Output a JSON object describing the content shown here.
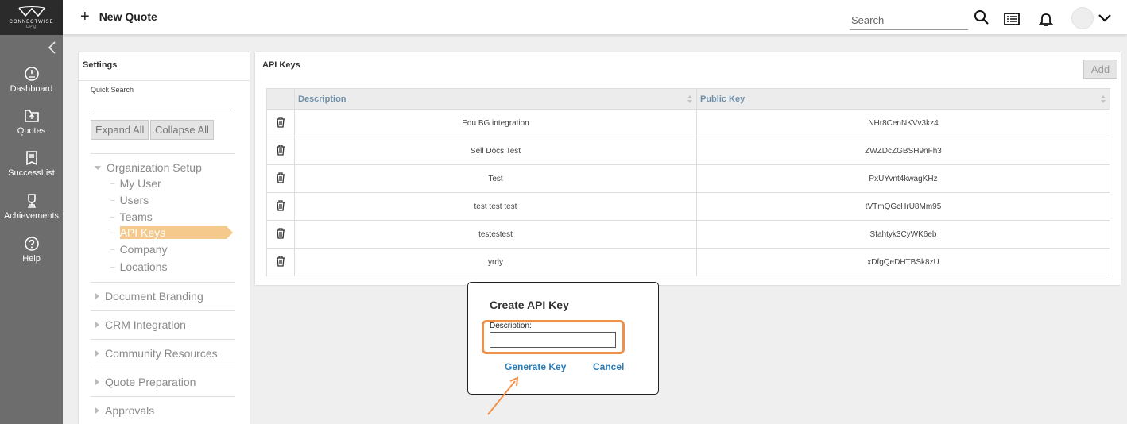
{
  "brand": {
    "name": "CONNECTWISE",
    "sub": "CPQ"
  },
  "nav": [
    {
      "label": "Dashboard",
      "icon": "dashboard-icon"
    },
    {
      "label": "Quotes",
      "icon": "quotes-icon"
    },
    {
      "label": "SuccessList",
      "icon": "successlist-icon"
    },
    {
      "label": "Achievements",
      "icon": "trophy-icon"
    },
    {
      "label": "Help",
      "icon": "help-icon"
    }
  ],
  "topbar": {
    "new_quote": "New Quote",
    "search_placeholder": "Search"
  },
  "settings": {
    "title": "Settings",
    "quick_search_label": "Quick Search",
    "expand_all": "Expand All",
    "collapse_all": "Collapse All",
    "org_setup": "Organization Setup",
    "org_items": [
      "My User",
      "Users",
      "Teams",
      "API Keys",
      "Company",
      "Locations"
    ],
    "categories": [
      "Document Branding",
      "CRM Integration",
      "Community Resources",
      "Quote Preparation",
      "Approvals"
    ]
  },
  "api_keys": {
    "title": "API Keys",
    "add_label": "Add",
    "columns": [
      "Description",
      "Public Key"
    ],
    "rows": [
      {
        "description": "Edu BG integration",
        "public_key": "NHr8CenNKVv3kz4"
      },
      {
        "description": "Sell Docs Test",
        "public_key": "ZWZDcZGBSH9nFh3"
      },
      {
        "description": "Test",
        "public_key": "PxUYvnt4kwagKHz"
      },
      {
        "description": "test test test",
        "public_key": "tVTmQGcHrU8Mm95"
      },
      {
        "description": "testestest",
        "public_key": "Sfahtyk3CyWK6eb"
      },
      {
        "description": "yrdy",
        "public_key": "xDfgQeDHTBSk8zU"
      }
    ]
  },
  "dialog": {
    "title": "Create API Key",
    "description_label": "Description:",
    "description_value": "",
    "generate_label": "Generate Key",
    "cancel_label": "Cancel"
  },
  "colors": {
    "accent": "#2b7db7",
    "highlight": "#f0914a",
    "active_item": "#f5c98c",
    "nav_bg": "#6d6d6d"
  }
}
